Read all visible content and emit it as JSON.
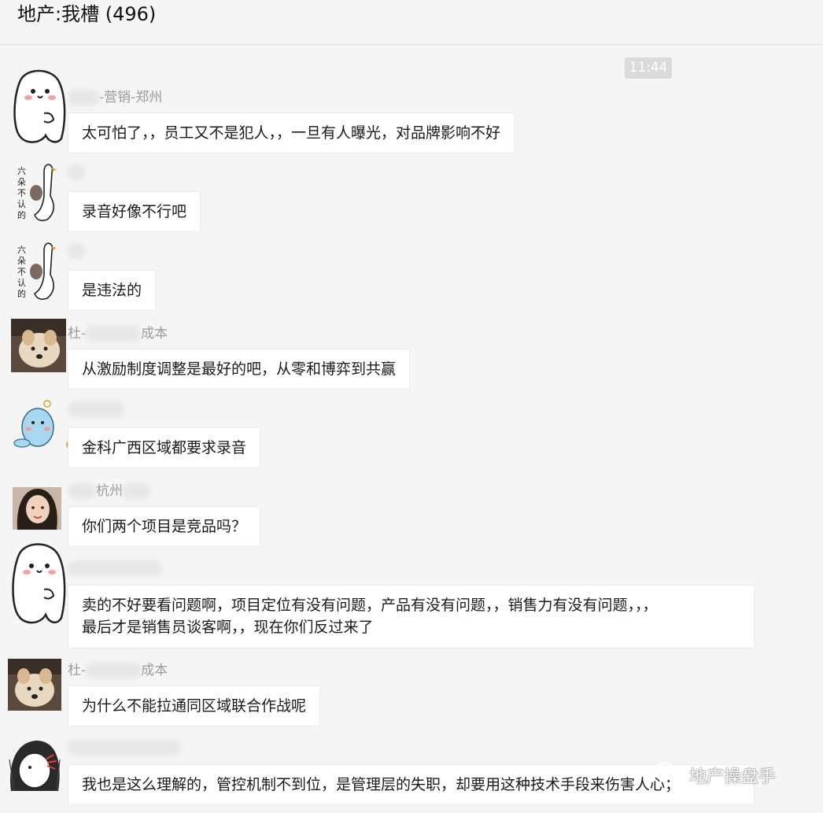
{
  "chat": {
    "title": "地产:我槽 (496)",
    "time": "11:44"
  },
  "messages": [
    {
      "sender_prefix": "",
      "sender_suffix": "-营销-郑州",
      "text": "太可怕了，，员工又不是犯人，，一旦有人曝光，对品牌影响不好"
    },
    {
      "sender_prefix": "",
      "sender_suffix": "",
      "text": "录音好像不行吧"
    },
    {
      "sender_prefix": "",
      "sender_suffix": "",
      "text": "是违法的"
    },
    {
      "sender_prefix": "杜-",
      "sender_suffix": "成本",
      "text": "从激励制度调整是最好的吧，从零和博弈到共赢"
    },
    {
      "sender_prefix": "",
      "sender_suffix": "",
      "text": "金科广西区域都要求录音"
    },
    {
      "sender_prefix": "",
      "sender_suffix": "杭州",
      "text": "你们两个项目是竞品吗？"
    },
    {
      "sender_prefix": "",
      "sender_suffix": "",
      "lines": [
        "卖的不好要看问题啊，项目定位有没有问题，产品有没有问题，，销售力有没有问题，，，",
        "最后才是销售员谈客啊，，现在你们反过来了"
      ]
    },
    {
      "sender_prefix": "杜-",
      "sender_suffix": "成本",
      "text": "为什么不能拉通同区域联合作战呢"
    },
    {
      "sender_prefix": "",
      "sender_suffix": "",
      "text": "我也是这么理解的，管控机制不到位，是管理层的失职，却要用这种技术手段来伤害人心；"
    }
  ],
  "watermark": {
    "text": "地产操盘手",
    "icon": "wechat-icon"
  }
}
